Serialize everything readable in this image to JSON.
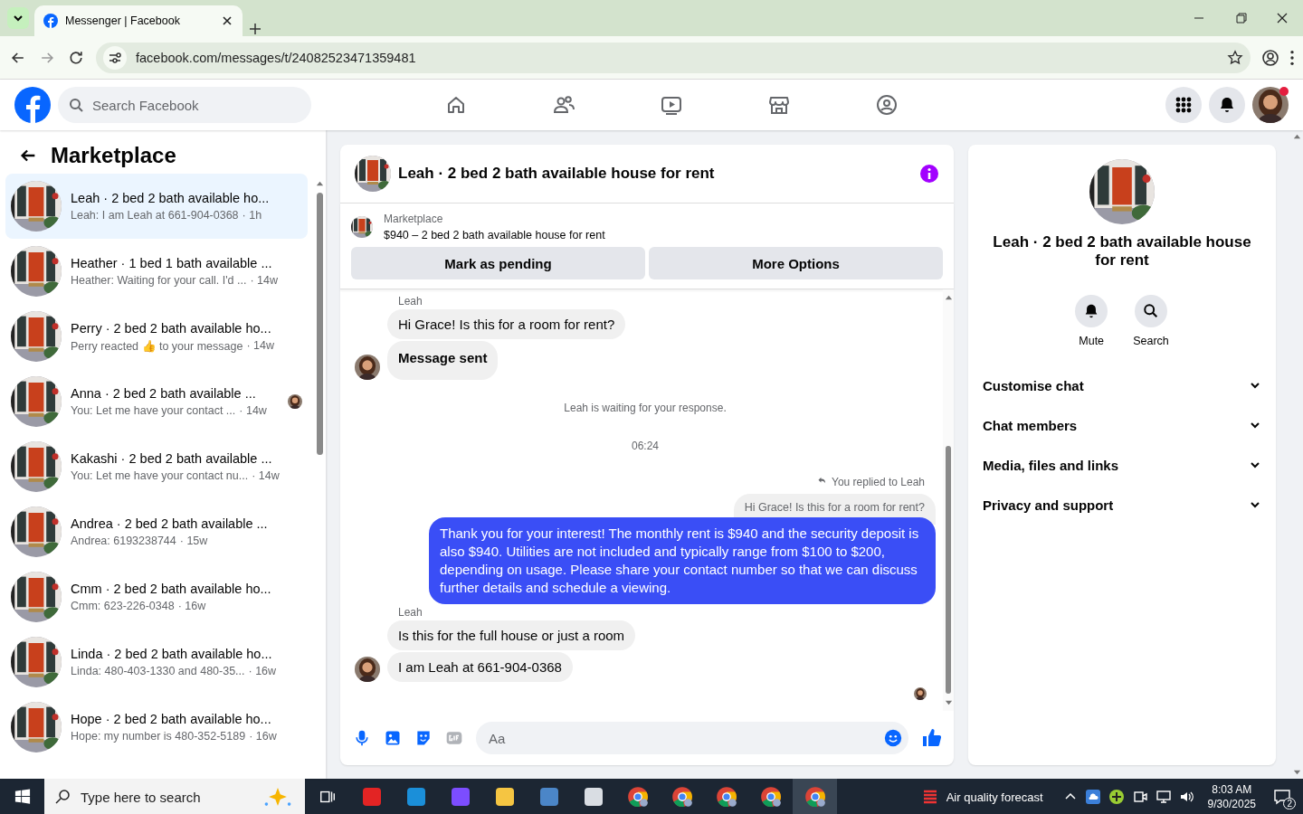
{
  "browser": {
    "tab_title": "Messenger | Facebook",
    "url": "facebook.com/messages/t/24082523471359481"
  },
  "header": {
    "search": {
      "placeholder": "Search Facebook"
    }
  },
  "sidebar": {
    "title": "Marketplace",
    "conversations": [
      {
        "title": "Leah · 2 bed 2 bath available ho...",
        "preview": "Leah: I am Leah at 661-904-0368",
        "time": "· 1h",
        "selected": true,
        "seen": false
      },
      {
        "title": "Heather · 1 bed 1 bath available ...",
        "preview": "Heather: Waiting for your call. I'd ...",
        "time": "· 14w",
        "selected": false,
        "seen": false
      },
      {
        "title": "Perry · 2 bed 2 bath available ho...",
        "preview": "Perry reacted 👍 to your message",
        "time": "· 14w",
        "selected": false,
        "seen": false
      },
      {
        "title": "Anna · 2 bed 2 bath available ...",
        "preview": "You: Let me have your contact ...",
        "time": "· 14w",
        "selected": false,
        "seen": true
      },
      {
        "title": "Kakashi · 2 bed 2 bath available ...",
        "preview": "You: Let me have your contact nu...",
        "time": "· 14w",
        "selected": false,
        "seen": false
      },
      {
        "title": "Andrea · 2 bed 2 bath available ...",
        "preview": "Andrea: 6193238744",
        "time": "· 15w",
        "selected": false,
        "seen": false
      },
      {
        "title": "Cmm · 2 bed 2 bath available ho...",
        "preview": "Cmm: 623-226-0348",
        "time": "· 16w",
        "selected": false,
        "seen": false
      },
      {
        "title": "Linda · 2 bed 2 bath available ho...",
        "preview": "Linda: 480-403-1330 and 480-35...",
        "time": "· 16w",
        "selected": false,
        "seen": false
      },
      {
        "title": "Hope · 2 bed 2 bath available ho...",
        "preview": "Hope: my number is 480-352-5189",
        "time": "· 16w",
        "selected": false,
        "seen": false
      }
    ]
  },
  "chat": {
    "title": "Leah · 2 bed 2 bath available house for rent",
    "listing": {
      "source": "Marketplace",
      "summary": "$940 – 2 bed 2 bath available house for rent"
    },
    "buttons": [
      "Mark as pending",
      "More Options"
    ],
    "messages": [
      {
        "kind": "sender",
        "text": "Leah"
      },
      {
        "kind": "incoming",
        "text": "Hi Grace! Is this for a room for rent?",
        "avatar": false
      },
      {
        "kind": "notice",
        "text": "Message sent",
        "avatar": true
      },
      {
        "kind": "status",
        "text": "Leah is waiting for your response."
      },
      {
        "kind": "status",
        "text": "06:24"
      },
      {
        "kind": "reply_note",
        "text": "You replied to Leah"
      },
      {
        "kind": "quote",
        "text": "Hi Grace! Is this for a room for rent?"
      },
      {
        "kind": "outgoing",
        "text": "Thank you for your interest! The monthly rent is $940 and the security deposit is also $940. Utilities are not included and typically range from $100 to $200, depending on usage. Please share your contact number so that we can discuss further details and schedule a viewing."
      },
      {
        "kind": "sender",
        "text": "Leah"
      },
      {
        "kind": "incoming",
        "text": "Is this for the full house or just a room",
        "avatar": false
      },
      {
        "kind": "incoming",
        "text": "I am Leah at 661-904-0368",
        "avatar": true
      },
      {
        "kind": "seen"
      }
    ],
    "composer": {
      "placeholder": "Aa"
    }
  },
  "details": {
    "title": "Leah · 2 bed 2 bath available house for rent",
    "actions": [
      "Mute",
      "Search"
    ],
    "sections": [
      "Customise chat",
      "Chat members",
      "Media, files and links",
      "Privacy and support"
    ]
  },
  "taskbar": {
    "search": {
      "placeholder": "Type here to search"
    },
    "weather": "Air quality forecast",
    "time": "8:03 AM",
    "date": "9/30/2025",
    "notifications": "2"
  }
}
